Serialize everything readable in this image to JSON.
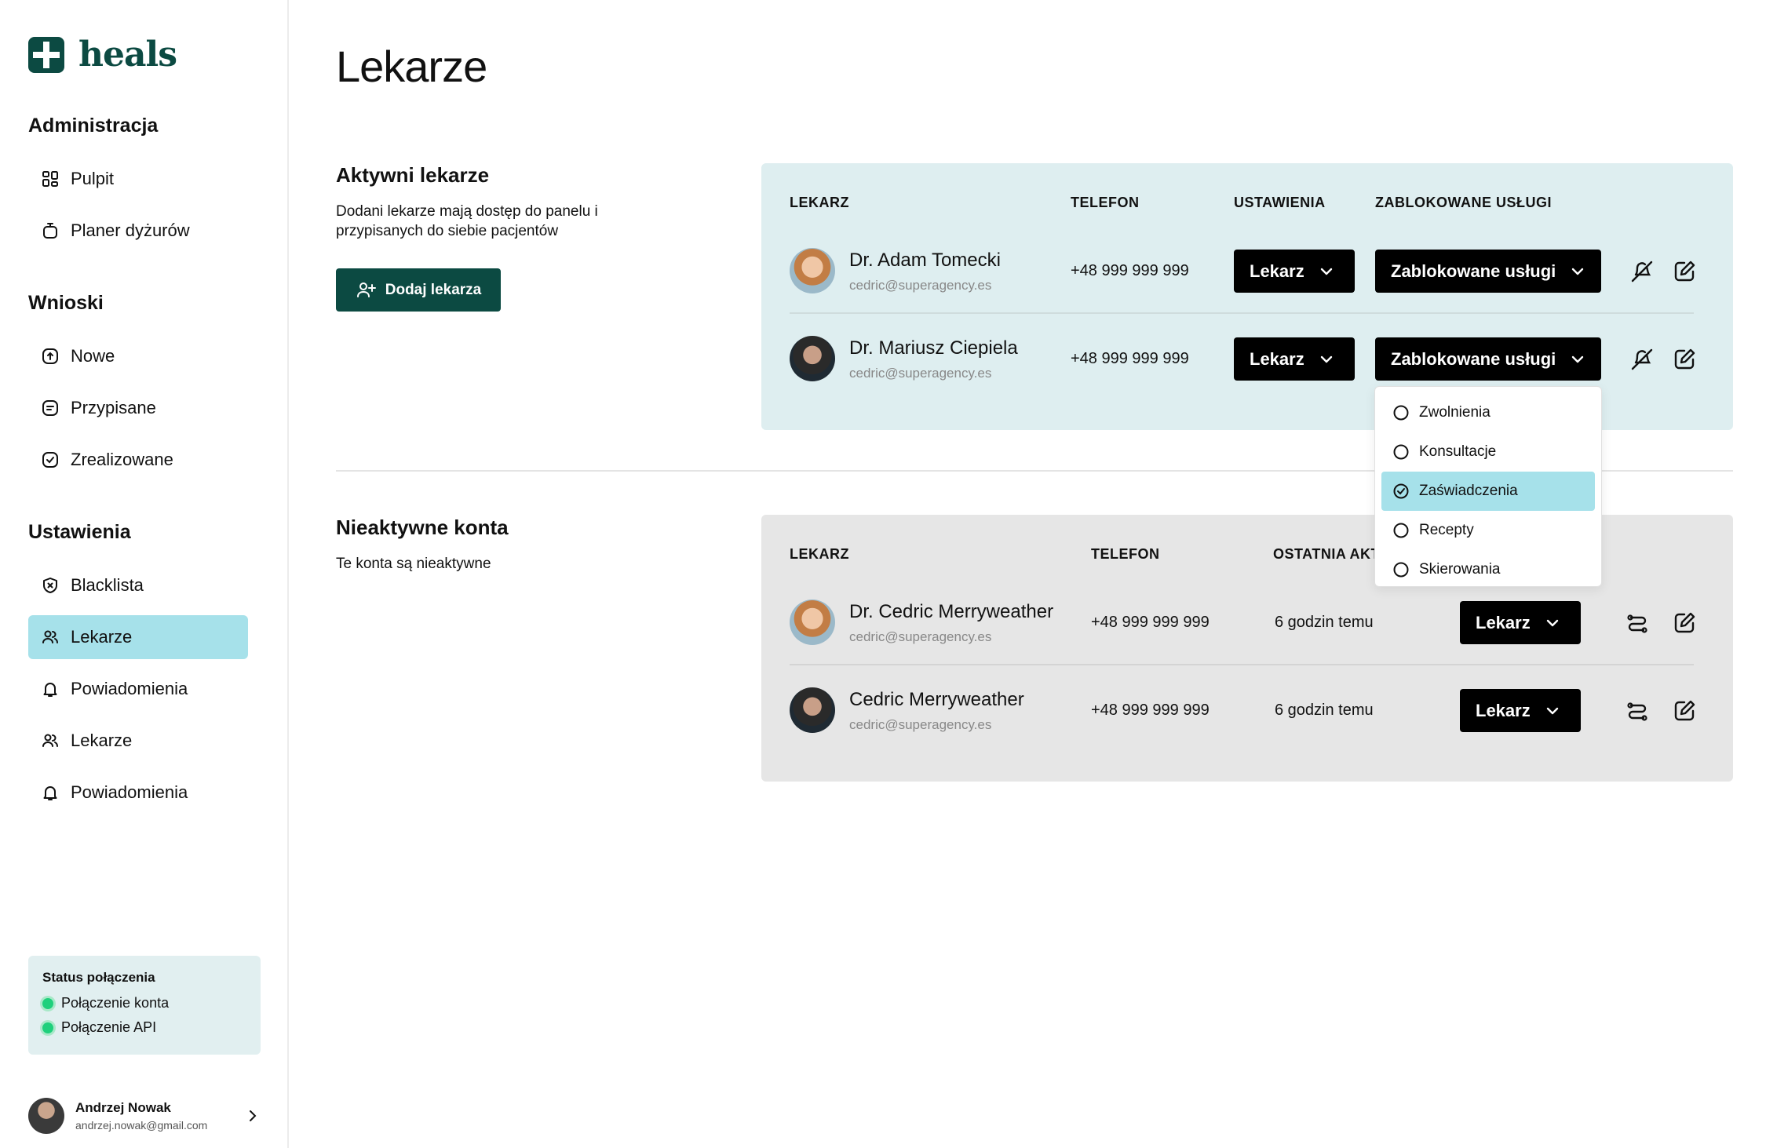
{
  "app": {
    "name": "heals"
  },
  "sidebar": {
    "sections": [
      {
        "title": "Administracja",
        "items": [
          {
            "label": "Pulpit",
            "icon": "dashboard-icon"
          },
          {
            "label": "Planer dyżurów",
            "icon": "timer-icon"
          }
        ]
      },
      {
        "title": "Wnioski",
        "items": [
          {
            "label": "Nowe",
            "icon": "new-request-icon"
          },
          {
            "label": "Przypisane",
            "icon": "assigned-icon"
          },
          {
            "label": "Zrealizowane",
            "icon": "completed-icon"
          }
        ]
      },
      {
        "title": "Ustawienia",
        "items": [
          {
            "label": "Blacklista",
            "icon": "shield-x-icon"
          },
          {
            "label": "Lekarze",
            "icon": "users-icon",
            "active": true
          },
          {
            "label": "Powiadomienia",
            "icon": "bell-icon"
          },
          {
            "label": "Lekarze",
            "icon": "users-icon"
          },
          {
            "label": "Powiadomienia",
            "icon": "bell-icon"
          }
        ]
      }
    ],
    "status": {
      "title": "Status połączenia",
      "items": [
        "Połączenie konta",
        "Połączenie API"
      ],
      "color": "#1fd07c"
    },
    "user": {
      "name": "Andrzej Nowak",
      "email": "andrzej.nowak@gmail.com"
    }
  },
  "page": {
    "title": "Lekarze"
  },
  "active": {
    "title": "Aktywni lekarze",
    "description": "Dodani lekarze mają dostęp do panelu i przypisanych do siebie pacjentów",
    "add_button": "Dodaj lekarza",
    "headers": {
      "doctor": "LEKARZ",
      "phone": "TELEFON",
      "settings": "USTAWIENIA",
      "blocked": "ZABLOKOWANE USŁUGI"
    },
    "rows": [
      {
        "name": "Dr. Adam Tomecki",
        "email": "cedric@superagency.es",
        "phone": "+48 999 999 999",
        "role": "Lekarz",
        "blocked": "Zablokowane usługi"
      },
      {
        "name": "Dr. Mariusz Ciepiela",
        "email": "cedric@superagency.es",
        "phone": "+48 999 999 999",
        "role": "Lekarz",
        "blocked": "Zablokowane usługi"
      }
    ]
  },
  "blocked_menu": {
    "options": [
      {
        "label": "Zwolnienia",
        "checked": false
      },
      {
        "label": "Konsultacje",
        "checked": false
      },
      {
        "label": "Zaświadczenia",
        "checked": true
      },
      {
        "label": "Recepty",
        "checked": false
      },
      {
        "label": "Skierowania",
        "checked": false
      }
    ]
  },
  "inactive": {
    "title": "Nieaktywne konta",
    "description": "Te konta są nieaktywne",
    "headers": {
      "doctor": "LEKARZ",
      "phone": "TELEFON",
      "last_activity": "OSTATNIA AKT"
    },
    "rows": [
      {
        "name": "Dr. Cedric Merryweather",
        "email": "cedric@superagency.es",
        "phone": "+48 999 999 999",
        "last": "6 godzin temu",
        "role": "Lekarz"
      },
      {
        "name": "Cedric Merryweather",
        "email": "cedric@superagency.es",
        "phone": "+48 999 999 999",
        "last": "6 godzin temu",
        "role": "Lekarz"
      }
    ]
  }
}
